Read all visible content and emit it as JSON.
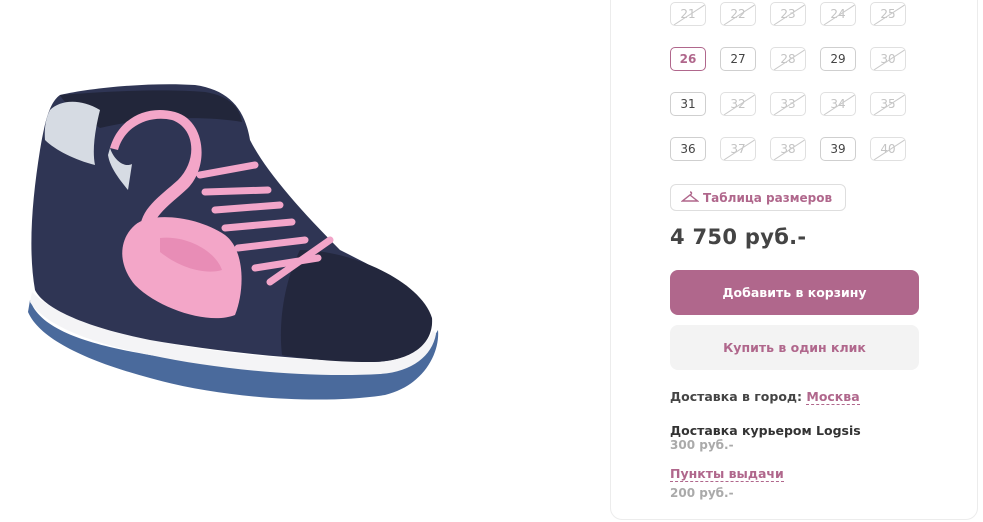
{
  "product": {
    "image_name": "pink-flamingo-sneaker-image"
  },
  "sizes": [
    {
      "label": "21",
      "available": false
    },
    {
      "label": "22",
      "available": false
    },
    {
      "label": "23",
      "available": false
    },
    {
      "label": "24",
      "available": false
    },
    {
      "label": "25",
      "available": false
    },
    {
      "label": "26",
      "available": true,
      "selected": true
    },
    {
      "label": "27",
      "available": true
    },
    {
      "label": "28",
      "available": false
    },
    {
      "label": "29",
      "available": true
    },
    {
      "label": "30",
      "available": false
    },
    {
      "label": "31",
      "available": true
    },
    {
      "label": "32",
      "available": false
    },
    {
      "label": "33",
      "available": false
    },
    {
      "label": "34",
      "available": false
    },
    {
      "label": "35",
      "available": false
    },
    {
      "label": "36",
      "available": true
    },
    {
      "label": "37",
      "available": false
    },
    {
      "label": "38",
      "available": false
    },
    {
      "label": "39",
      "available": true
    },
    {
      "label": "40",
      "available": false
    }
  ],
  "size_chart": {
    "label": "Таблица размеров",
    "icon": "hanger-icon"
  },
  "price": "4 750 руб.-",
  "buttons": {
    "add_to_cart": "Добавить в корзину",
    "one_click": "Купить в один клик"
  },
  "delivery": {
    "city_label": "Доставка в город:",
    "city": "Москва",
    "courier_label": "Доставка курьером Logsis",
    "courier_price": "300 руб.-",
    "pickup_label": "Пункты выдачи",
    "pickup_price": "200 руб.-"
  },
  "colors": {
    "accent": "#b0678c",
    "navy": "#2f3554",
    "pink": "#f3a6c8"
  }
}
